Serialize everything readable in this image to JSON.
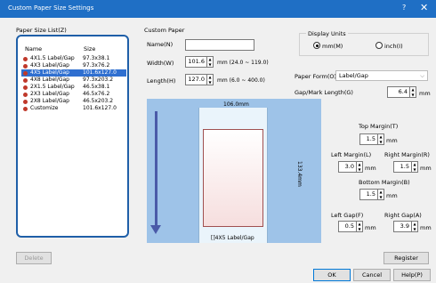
{
  "window": {
    "title": "Custom Paper Size Settings",
    "help_glyph": "?",
    "close_glyph": "✕"
  },
  "paper_list": {
    "group_label": "Paper Size List(Z)",
    "columns": [
      "Name",
      "Size"
    ],
    "rows": [
      {
        "name": "4X1.5 Label/Gap",
        "size": "97.3x38.1",
        "selected": false
      },
      {
        "name": "4X3 Label/Gap",
        "size": "97.3x76.2",
        "selected": false
      },
      {
        "name": "4X5 Label/Gap",
        "size": "101.6x127.0",
        "selected": true
      },
      {
        "name": "4X8 Label/Gap",
        "size": "97.3x203.2",
        "selected": false
      },
      {
        "name": "2X1.5 Label/Gap",
        "size": "46.5x38.1",
        "selected": false
      },
      {
        "name": "2X3 Label/Gap",
        "size": "46.5x76.2",
        "selected": false
      },
      {
        "name": "2X8 Label/Gap",
        "size": "46.5x203.2",
        "selected": false
      },
      {
        "name": "Customize",
        "size": "101.6x127.0",
        "selected": false
      }
    ]
  },
  "custom_paper": {
    "group_label": "Custom Paper",
    "name_label": "Name(N)",
    "name_value": "",
    "width_label": "Width(W)",
    "width_value": "101.6",
    "width_range": "mm (24.0 ~ 119.0)",
    "length_label": "Length(H)",
    "length_value": "127.0",
    "length_range": "mm (6.0 ~ 400.0)"
  },
  "display_units": {
    "label": "Display Units",
    "mm_label": "mm(M)",
    "inch_label": "inch(I)",
    "selected": "mm"
  },
  "paper_form": {
    "label": "Paper Form(O)",
    "value": "Label/Gap"
  },
  "gap_mark": {
    "label": "Gap/Mark Length(G)",
    "value": "6.4",
    "unit": "mm"
  },
  "preview": {
    "width_text": "106.0mm",
    "height_text": "133.4mm",
    "caption": "[]4X5 Label/Gap"
  },
  "margins": {
    "top_label": "Top Margin(T)",
    "top_value": "1.5",
    "left_label": "Left Margin(L)",
    "left_value": "3.0",
    "right_label": "Right Margin(R)",
    "right_value": "1.5",
    "bottom_label": "Bottom Margin(B)",
    "bottom_value": "1.5",
    "unit": "mm"
  },
  "gaps": {
    "left_label": "Left Gap(F)",
    "left_value": "0.5",
    "right_label": "Right Gap(A)",
    "right_value": "3.9",
    "unit": "mm"
  },
  "buttons": {
    "delete": "Delete",
    "register": "Register",
    "ok": "OK",
    "cancel": "Cancel",
    "help": "Help(P)"
  },
  "colors": {
    "titlebar": "#1f6fc5",
    "selection": "#2f6fd0",
    "preview_bg": "#9ec3e8",
    "arrow": "#4a5aa8"
  }
}
